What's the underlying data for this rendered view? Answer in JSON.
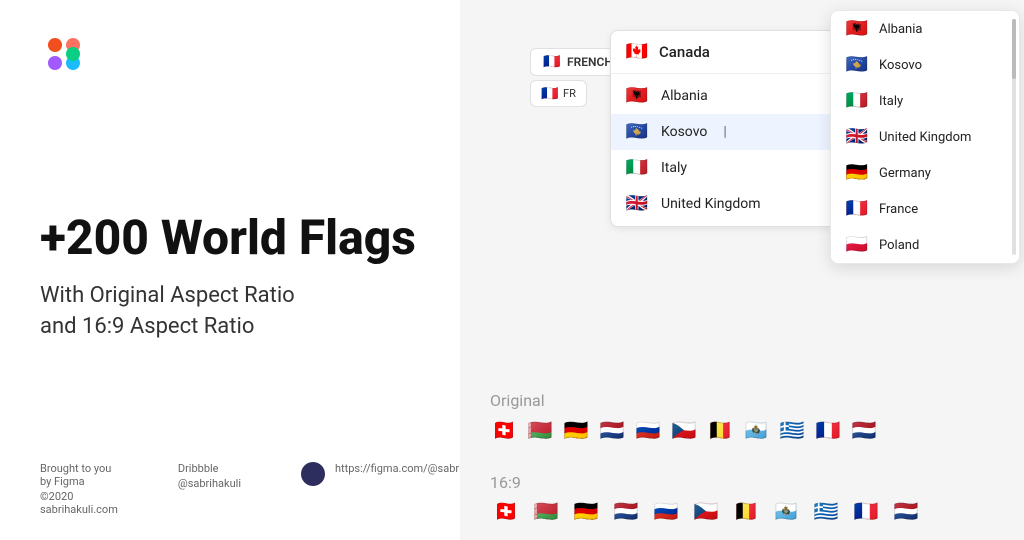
{
  "left": {
    "title_part1": "+200 World Flags",
    "subtitle": "With Original Aspect Ratio\nand 16:9 Aspect Ratio",
    "footer": {
      "credit": "Brought to you by Figma\n©2020 sabrihakuli.com",
      "dribbble_label": "Dribbble",
      "dribbble_handle": "@sabrihakuli",
      "figma_link": "https://figma.com/@sabrihakuli"
    }
  },
  "right": {
    "french_button": "FRENCH",
    "fr_badge": "FR",
    "selected_country": "Canada",
    "dropdown_items": [
      {
        "name": "Albania",
        "flag": "🇦🇱"
      },
      {
        "name": "Kosovo",
        "flag": "🇽🇰"
      },
      {
        "name": "Italy",
        "flag": "🇮🇹"
      },
      {
        "name": "United Kingdom",
        "flag": "🇬🇧"
      }
    ],
    "right_dropdown_items": [
      {
        "name": "Albania",
        "flag": "🇦🇱"
      },
      {
        "name": "Kosovo",
        "flag": "🇽🇰"
      },
      {
        "name": "Italy",
        "flag": "🇮🇹"
      },
      {
        "name": "United Kingdom",
        "flag": "🇬🇧"
      },
      {
        "name": "Germany",
        "flag": "🇩🇪"
      },
      {
        "name": "France",
        "flag": "🇫🇷"
      },
      {
        "name": "Poland",
        "flag": "🇵🇱"
      }
    ],
    "original_label": "Original",
    "ratio_label": "16:9",
    "flags_row": [
      "🇨🇭",
      "🇧🇾",
      "🇩🇪",
      "🇳🇱",
      "🇷🇺",
      "🇨🇿",
      "🇧🇪",
      "🇸🇲",
      "🇬🇷",
      "🇫🇷",
      "🇳🇱"
    ]
  }
}
